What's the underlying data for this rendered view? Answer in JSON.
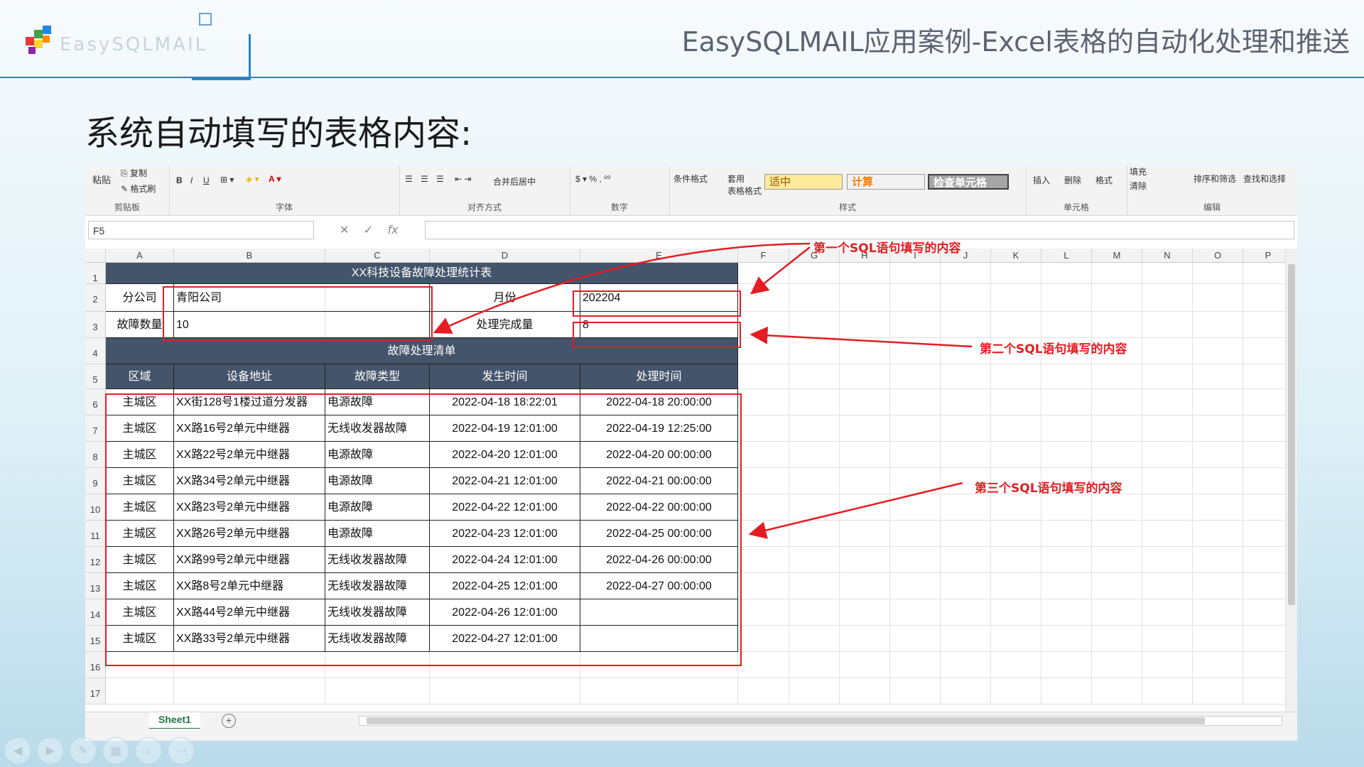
{
  "logo": {
    "text": "EasySQLMAIL"
  },
  "slide": {
    "title": "EasySQLMAIL应用案例-Excel表格的自动化处理和推送",
    "heading": "系统自动填写的表格内容:"
  },
  "ribbon": {
    "paste": "粘贴",
    "copy": "复制",
    "format_painter": "格式刷",
    "group_clipboard": "剪贴板",
    "group_font": "字体",
    "merge_center": "合并后居中",
    "group_alignment": "对齐方式",
    "group_number": "数字",
    "conditional_format": "条件格式",
    "table_format_1": "套用",
    "table_format_2": "表格格式",
    "style_neutral": "适中",
    "style_calc": "计算",
    "style_check": "检查单元格",
    "group_styles": "样式",
    "insert": "插入",
    "delete": "删除",
    "format": "格式",
    "group_cells": "单元格",
    "fill": "填充",
    "clear": "清除",
    "sort_filter": "排序和筛选",
    "find_select": "查找和选择",
    "group_editing": "编辑"
  },
  "formula_bar": {
    "name_box": "F5",
    "fx": "fx",
    "value": ""
  },
  "columns": [
    "A",
    "B",
    "C",
    "D",
    "E",
    "F",
    "G",
    "H",
    "I",
    "J",
    "K",
    "L",
    "M",
    "N",
    "O",
    "P"
  ],
  "rows": [
    "1",
    "2",
    "3",
    "4",
    "5",
    "6",
    "7",
    "8",
    "9",
    "10",
    "11",
    "12",
    "13",
    "14",
    "15",
    "16",
    "17"
  ],
  "sheet": {
    "title": "XX科技设备故障处理统计表",
    "company_label": "分公司",
    "company_value": "青阳公司",
    "month_label": "月份",
    "month_value": "202204",
    "fault_count_label": "故障数量",
    "fault_count_value": "10",
    "done_label": "处理完成量",
    "done_value": "8",
    "list_title": "故障处理清单",
    "headers": [
      "区域",
      "设备地址",
      "故障类型",
      "发生时间",
      "处理时间"
    ],
    "records": [
      [
        "主城区",
        "XX街128号1楼过道分发器",
        "电源故障",
        "2022-04-18 18:22:01",
        "2022-04-18 20:00:00"
      ],
      [
        "主城区",
        "XX路16号2单元中继器",
        "无线收发器故障",
        "2022-04-19 12:01:00",
        "2022-04-19 12:25:00"
      ],
      [
        "主城区",
        "XX路22号2单元中继器",
        "电源故障",
        "2022-04-20 12:01:00",
        "2022-04-20 00:00:00"
      ],
      [
        "主城区",
        "XX路34号2单元中继器",
        "电源故障",
        "2022-04-21 12:01:00",
        "2022-04-21 00:00:00"
      ],
      [
        "主城区",
        "XX路23号2单元中继器",
        "电源故障",
        "2022-04-22 12:01:00",
        "2022-04-22 00:00:00"
      ],
      [
        "主城区",
        "XX路26号2单元中继器",
        "电源故障",
        "2022-04-23 12:01:00",
        "2022-04-25 00:00:00"
      ],
      [
        "主城区",
        "XX路99号2单元中继器",
        "无线收发器故障",
        "2022-04-24 12:01:00",
        "2022-04-26 00:00:00"
      ],
      [
        "主城区",
        "XX路8号2单元中继器",
        "无线收发器故障",
        "2022-04-25 12:01:00",
        "2022-04-27 00:00:00"
      ],
      [
        "主城区",
        "XX路44号2单元中继器",
        "无线收发器故障",
        "2022-04-26 12:01:00",
        ""
      ],
      [
        "主城区",
        "XX路33号2单元中继器",
        "无线收发器故障",
        "2022-04-27 12:01:00",
        ""
      ]
    ]
  },
  "tabs": {
    "sheet1": "Sheet1",
    "add": "+"
  },
  "annotations": {
    "first": "第一个SQL语句填写的内容",
    "second": "第二个SQL语句填写的内容",
    "third": "第三个SQL语句填写的内容"
  },
  "colors": {
    "header_fill": "#44546a",
    "annotation": "#e51c23",
    "sheet_tab": "#217346",
    "accent": "#2f7fb8"
  },
  "icons": [
    "logo-cubes-icon",
    "copy-icon",
    "format-painter-icon",
    "bold-icon",
    "italic-icon",
    "underline-icon",
    "fill-color-icon",
    "font-color-icon",
    "cancel-icon",
    "confirm-icon",
    "fx-icon",
    "add-sheet-icon",
    "prev-slide-icon",
    "next-slide-icon",
    "pen-icon",
    "grid-view-icon",
    "zoom-icon",
    "more-icon"
  ]
}
